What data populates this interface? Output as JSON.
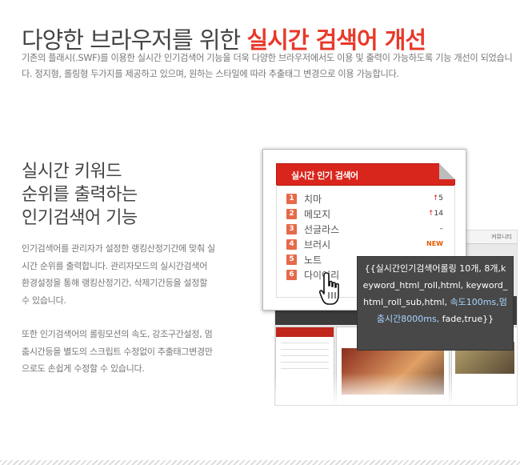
{
  "hero": {
    "title_plain": "다양한 브라우저를 위한 ",
    "title_accent": "실시간 검색어 개선"
  },
  "intro": {
    "text": "기존의 플래시(.SWF)를 이용한 실시간 인기검색어 기능을 더욱 다양한 브라우저에서도 이용 및 출력이 가능하도록 기능 개선이 되었습니다. 정지형, 롤링형 두가지를 제공하고 있으며, 원하는 스타일에 따라 추출태그 변경으로 이용 가능합니다."
  },
  "section": {
    "heading_lines": [
      "실시간 키워드",
      "순위를 출력하는",
      "인기검색어 기능"
    ],
    "paragraph1": "인기검색어를 관리자가 설정한 랭킹산정기간에 맞춰 실시간 순위를 출력합니다. 관리자모드의 실시간검색어 환경설정을 통해 랭킹산정기간, 삭제기간등을 설정할 수 있습니다.",
    "paragraph2": "또한 인기검색어의 롤링모션의 속도, 강조구간설정, 멈춤시간등을 별도의 스크립트 수정없이 추출태그변경만으로도 손쉽게 수정할 수 있습니다."
  },
  "widget": {
    "title": "실시간 인기 검색어",
    "items": [
      {
        "rank": "1",
        "word": "치마",
        "change": "5",
        "trend": "up"
      },
      {
        "rank": "2",
        "word": "메모지",
        "change": "14",
        "trend": "up"
      },
      {
        "rank": "3",
        "word": "선글라스",
        "change": "–",
        "trend": "same"
      },
      {
        "rank": "4",
        "word": "브러시",
        "change": "NEW",
        "trend": "new"
      },
      {
        "rank": "5",
        "word": "노트",
        "change": "",
        "trend": ""
      },
      {
        "rank": "6",
        "word": "다이어리",
        "change": "",
        "trend": ""
      }
    ]
  },
  "tooltip": {
    "part1": "{{실시간인기검색어롤링 10개, 8개,keyword_html_roll,html, keyword_html_roll_sub,html, ",
    "highlight": "속도100ms,멈춤시간8000ms,",
    "part2": " fade,true}}"
  },
  "mockup": {
    "top_right": "커뮤니티"
  },
  "colors": {
    "accent": "#e8392a",
    "widget_header": "#d9261c",
    "rank_badge": "#e66a4a",
    "tooltip_bg": "#484848"
  },
  "icons": {
    "cursor": "hand-pointer-icon",
    "trend_up": "arrow-up-icon"
  }
}
